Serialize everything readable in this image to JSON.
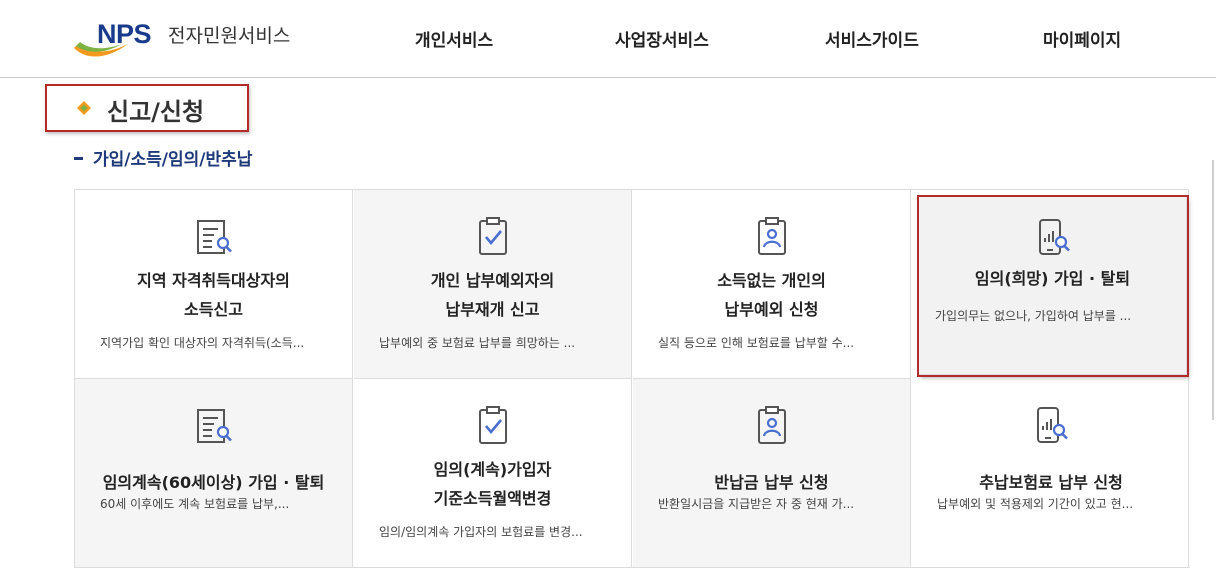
{
  "header": {
    "logo_mark": "NPS",
    "logo_sub": "전자민원서비스",
    "nav": [
      "개인서비스",
      "사업장서비스",
      "서비스가이드",
      "마이페이지"
    ]
  },
  "section": {
    "title": "신고/신청",
    "subtitle": "가입/소득/임의/반추납"
  },
  "cards": [
    {
      "title1": "지역 자격취득대상자의",
      "title2": "소득신고",
      "desc": "지역가입 확인 대상자의 자격취득(소득...",
      "icon": "document-search-icon"
    },
    {
      "title1": "개인 납부예외자의",
      "title2": "납부재개 신고",
      "desc": "납부예외 중 보험료 납부를 희망하는 ...",
      "icon": "clipboard-check-icon"
    },
    {
      "title1": "소득없는 개인의",
      "title2": "납부예외 신청",
      "desc": "실직 등으로 인해 보험료를 납부할 수...",
      "icon": "clipboard-person-icon"
    },
    {
      "title1": "임의(희망) 가입 · 탈퇴",
      "title2": "",
      "desc": "가입의무는 없으나, 가입하여 납부를 ...",
      "icon": "mobile-chart-search-icon"
    },
    {
      "title1": "임의계속(60세이상) 가입 · 탈퇴",
      "title2": "",
      "desc": "60세 이후에도 계속 보험료를 납부,...",
      "icon": "document-search-icon"
    },
    {
      "title1": "임의(계속)가입자",
      "title2": "기준소득월액변경",
      "desc": "임의/임의계속 가입자의 보험료를 변경...",
      "icon": "clipboard-check-icon"
    },
    {
      "title1": "반납금 납부 신청",
      "title2": "",
      "desc": "반환일시금을 지급받은 자 중 현재 가...",
      "icon": "clipboard-person-icon"
    },
    {
      "title1": "추납보험료 납부 신청",
      "title2": "",
      "desc": "납부예외 및 적용제외 기간이 있고 현...",
      "icon": "mobile-chart-search-icon"
    }
  ],
  "colors": {
    "brand_blue": "#1a3b8c",
    "icon_blue": "#4a6fd1",
    "highlight_red": "#b22a2a",
    "diamond_orange": "#f39a1e",
    "diamond_green": "#7cb342"
  }
}
